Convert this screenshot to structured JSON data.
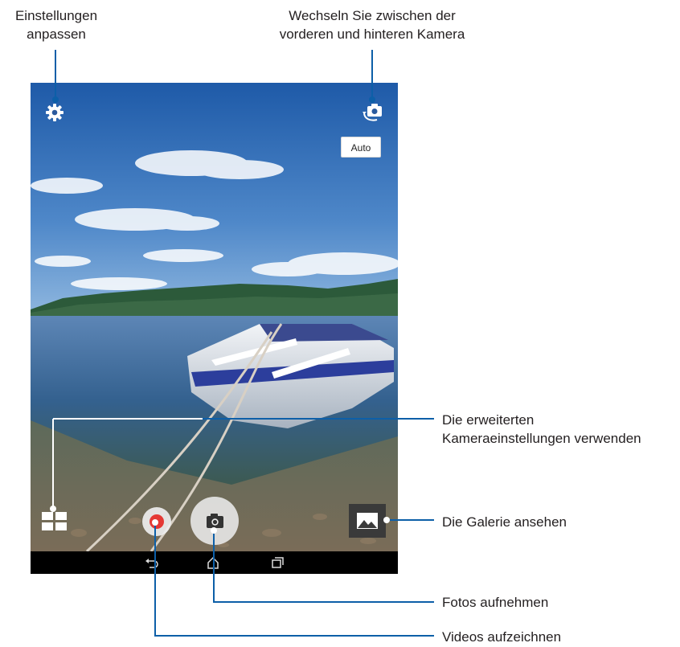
{
  "callouts": {
    "settings": {
      "line1": "Einstellungen",
      "line2": "anpassen"
    },
    "switch_camera": {
      "line1": "Wechseln Sie zwischen der",
      "line2": "vorderen und hinteren Kamera"
    },
    "advanced": {
      "line1": "Die erweiterten",
      "line2": "Kameraeinstellungen verwenden"
    },
    "gallery": "Die Galerie ansehen",
    "photo": "Fotos aufnehmen",
    "video": "Videos aufzeichnen"
  },
  "camera": {
    "scene_mode_label": "Auto"
  },
  "icons": {
    "settings": "gear-icon",
    "switch_camera": "camera-switch-icon",
    "modes": "grid-icon",
    "record": "record-icon",
    "shutter": "camera-icon",
    "gallery": "image-icon",
    "back": "back-icon",
    "home": "home-icon",
    "recent": "recent-apps-icon"
  },
  "colors": {
    "callout_line": "#0d5fa8",
    "record_red": "#e53935",
    "navbar": "#000000"
  }
}
